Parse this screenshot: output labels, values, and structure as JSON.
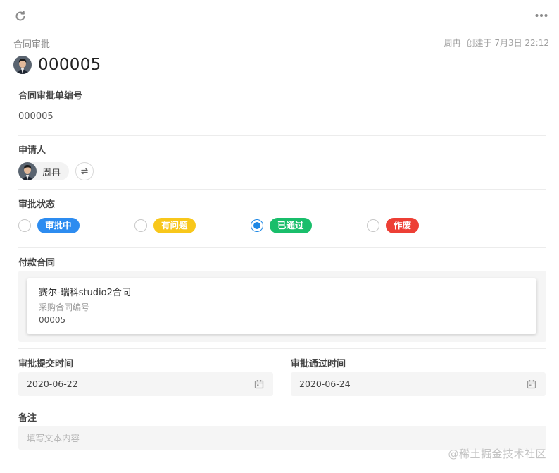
{
  "header": {
    "refresh_icon": "refresh-icon",
    "more_icon": "more-horizontal-icon",
    "breadcrumb": "合同审批",
    "creator": "周冉",
    "created_text": "创建于 7月3日 22:12"
  },
  "record": {
    "title": "000005"
  },
  "fields": {
    "number": {
      "label": "合同审批单编号",
      "value": "000005"
    },
    "applicant": {
      "label": "申请人",
      "name": "周冉"
    },
    "status": {
      "label": "审批状态",
      "options": [
        {
          "label": "审批中",
          "color": "#2d8cf0",
          "checked": false
        },
        {
          "label": "有问题",
          "color": "#f8c71b",
          "checked": false
        },
        {
          "label": "已通过",
          "color": "#19be6b",
          "checked": true
        },
        {
          "label": "作废",
          "color": "#ed3f35",
          "checked": false
        }
      ]
    },
    "contract": {
      "label": "付款合同",
      "name": "赛尔-瑞科studio2合同",
      "sub_label": "采购合同编号",
      "sub_value": "00005"
    },
    "submit_time": {
      "label": "审批提交时间",
      "value": "2020-06-22"
    },
    "pass_time": {
      "label": "审批通过时间",
      "value": "2020-06-24"
    },
    "note": {
      "label": "备注",
      "placeholder": "填写文本内容"
    }
  },
  "watermark": "@稀土掘金技术社区"
}
